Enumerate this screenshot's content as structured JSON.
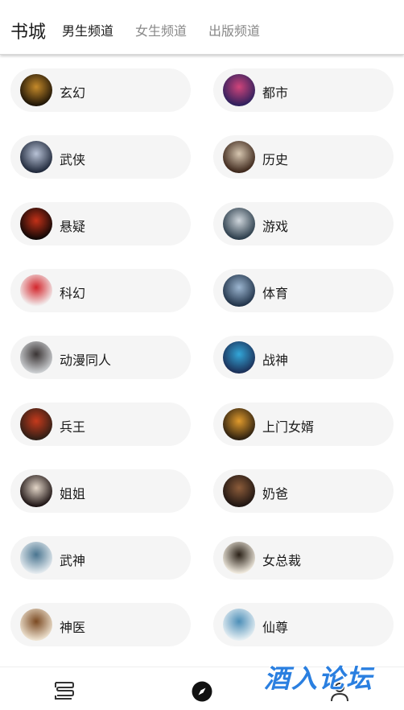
{
  "header": {
    "title": "书城",
    "tabs": [
      {
        "label": "男生频道",
        "active": true
      },
      {
        "label": "女生频道",
        "active": false
      },
      {
        "label": "出版频道",
        "active": false
      }
    ]
  },
  "categories": [
    {
      "label": "玄幻",
      "cover": [
        "#1b1206",
        "#c58a2a"
      ]
    },
    {
      "label": "都市",
      "cover": [
        "#2b1f5c",
        "#d0447a"
      ]
    },
    {
      "label": "武侠",
      "cover": [
        "#1d2638",
        "#b8c2d6"
      ]
    },
    {
      "label": "历史",
      "cover": [
        "#3a2418",
        "#d6c6b0"
      ]
    },
    {
      "label": "悬疑",
      "cover": [
        "#0d0706",
        "#c23118"
      ]
    },
    {
      "label": "游戏",
      "cover": [
        "#283a48",
        "#cfd6dc"
      ]
    },
    {
      "label": "科幻",
      "cover": [
        "#f3f3f3",
        "#d3262c"
      ]
    },
    {
      "label": "体育",
      "cover": [
        "#1e3046",
        "#9cb6d1"
      ]
    },
    {
      "label": "动漫同人",
      "cover": [
        "#cdd0d3",
        "#3a3434"
      ]
    },
    {
      "label": "战神",
      "cover": [
        "#1b2d55",
        "#33a6d8"
      ]
    },
    {
      "label": "兵王",
      "cover": [
        "#2c1e16",
        "#c53a1c"
      ]
    },
    {
      "label": "上门女婿",
      "cover": [
        "#2a1e10",
        "#e09a2c"
      ]
    },
    {
      "label": "姐姐",
      "cover": [
        "#1a1010",
        "#e3d6c8"
      ]
    },
    {
      "label": "奶爸",
      "cover": [
        "#1d1411",
        "#8c5c3a"
      ]
    },
    {
      "label": "武神",
      "cover": [
        "#e6ecf0",
        "#4a7590"
      ]
    },
    {
      "label": "女总裁",
      "cover": [
        "#f2ece0",
        "#2b2218"
      ]
    },
    {
      "label": "神医",
      "cover": [
        "#efe4d2",
        "#7b4a22"
      ]
    },
    {
      "label": "仙尊",
      "cover": [
        "#e8f0f4",
        "#4d8fb8"
      ]
    }
  ],
  "bottom_nav": [
    {
      "icon": "bookshelf-icon"
    },
    {
      "icon": "compass-icon",
      "active": true
    },
    {
      "icon": "profile-icon"
    }
  ],
  "watermark": "酒入论坛",
  "colors": {
    "active_tab": "#1a1a1a",
    "inactive_tab": "#888888",
    "chip_bg": "#f5f5f5",
    "watermark": "#2a7fe0"
  }
}
